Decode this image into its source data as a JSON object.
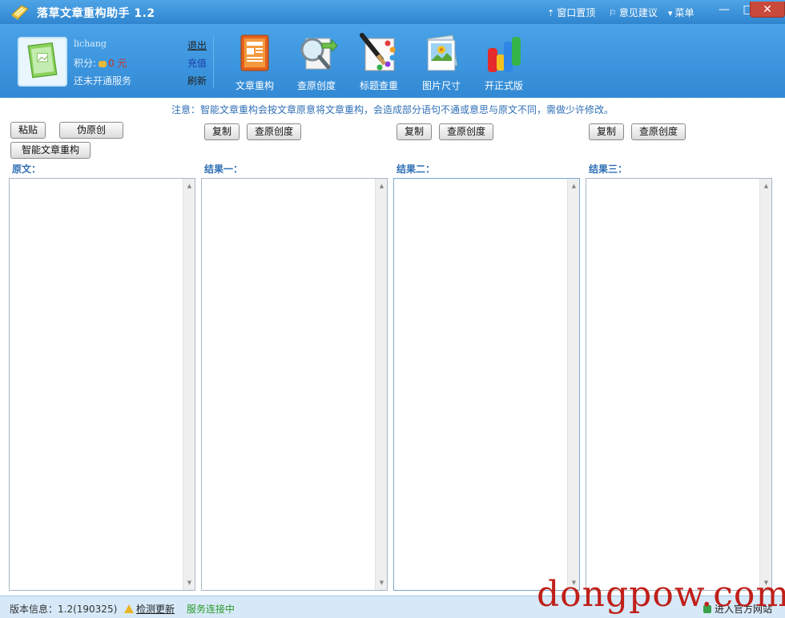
{
  "app": {
    "title": "落草文章重构助手 1.2"
  },
  "titlebar": {
    "pin_label": "窗口置顶",
    "feedback_label": "意见建议",
    "menu_label": "菜单"
  },
  "user": {
    "name": "lichang",
    "points_label": "积分:",
    "points_value": "0",
    "points_unit": "元",
    "service_status": "还未开通服务"
  },
  "account_links": {
    "logout": "退出",
    "recharge": "充值",
    "refresh": "刷新"
  },
  "tools": [
    {
      "label": "文章重构",
      "icon": "document-icon"
    },
    {
      "label": "查原创度",
      "icon": "magnifier-icon"
    },
    {
      "label": "标题查重",
      "icon": "brush-palette-icon"
    },
    {
      "label": "图片尺寸",
      "icon": "picture-icon"
    },
    {
      "label": "开正式版",
      "icon": "colorful-bars-icon"
    }
  ],
  "notice": "注意：智能文章重构会按文章原意将文章重构，会造成部分语句不通或意思与原文不同，需做少许修改。",
  "source": {
    "paste": "粘贴",
    "pseudo": "伪原创",
    "smart": "智能文章重构",
    "label": "原文："
  },
  "results": [
    {
      "label": "结果一：",
      "copy": "复制",
      "check": "查原创度"
    },
    {
      "label": "结果二：",
      "copy": "复制",
      "check": "查原创度"
    },
    {
      "label": "结果三：",
      "copy": "复制",
      "check": "查原创度"
    }
  ],
  "status": {
    "version": "版本信息：1.2(190325)",
    "update": "检测更新",
    "connection": "服务连接中",
    "site": "进入官方网站"
  },
  "watermark": "dongpow.com",
  "colors": {
    "titlebar": "#3b94dd",
    "notice": "#2f6fb5",
    "connection": "#2b9a2b",
    "watermark": "#c0201a"
  }
}
